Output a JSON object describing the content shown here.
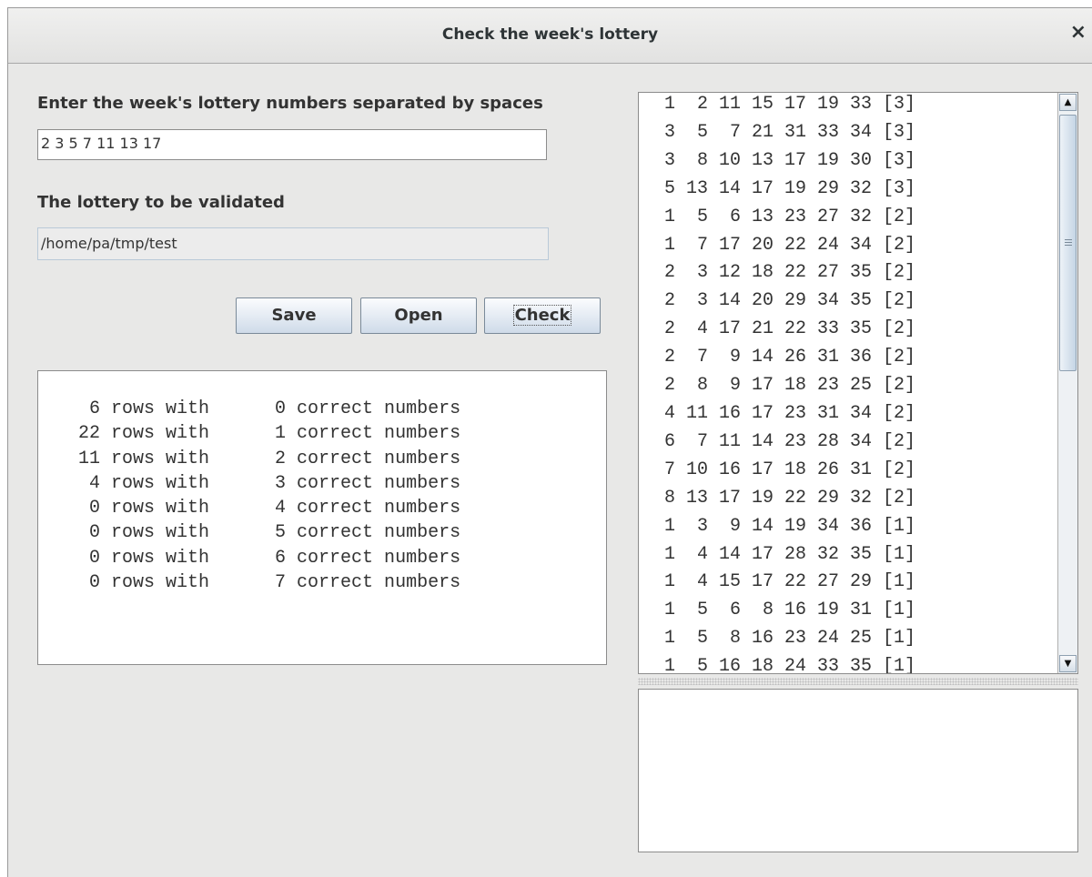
{
  "window": {
    "title": "Check the week's lottery",
    "close_label": "×"
  },
  "form": {
    "numbers_label": "Enter the week's lottery numbers separated by spaces",
    "numbers_value": "2 3 5 7 11 13 17",
    "file_label": "The lottery to be validated",
    "file_value": "/home/pa/tmp/test"
  },
  "buttons": {
    "save": "Save",
    "open": "Open",
    "check": "Check"
  },
  "results_text": "    6 rows with      0 correct numbers\n   22 rows with      1 correct numbers\n   11 rows with      2 correct numbers\n    4 rows with      3 correct numbers\n    0 rows with      4 correct numbers\n    0 rows with      5 correct numbers\n    0 rows with      6 correct numbers\n    0 rows with      7 correct numbers",
  "lottery_rows_text": "  1  2 11 15 17 19 33 [3]\n  3  5  7 21 31 33 34 [3]\n  3  8 10 13 17 19 30 [3]\n  5 13 14 17 19 29 32 [3]\n  1  5  6 13 23 27 32 [2]\n  1  7 17 20 22 24 34 [2]\n  2  3 12 18 22 27 35 [2]\n  2  3 14 20 29 34 35 [2]\n  2  4 17 21 22 33 35 [2]\n  2  7  9 14 26 31 36 [2]\n  2  8  9 17 18 23 25 [2]\n  4 11 16 17 23 31 34 [2]\n  6  7 11 14 23 28 34 [2]\n  7 10 16 17 18 26 31 [2]\n  8 13 17 19 22 29 32 [2]\n  1  3  9 14 19 34 36 [1]\n  1  4 14 17 28 32 35 [1]\n  1  4 15 17 22 27 29 [1]\n  1  5  6  8 16 19 31 [1]\n  1  5  8 16 23 24 25 [1]\n  1  5 16 18 24 33 35 [1]",
  "scrollbar": {
    "up_glyph": "▲",
    "down_glyph": "▼"
  },
  "bottom_pane_text": ""
}
